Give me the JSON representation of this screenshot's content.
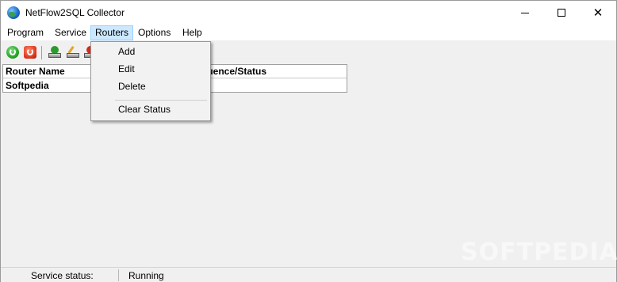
{
  "window": {
    "title": "NetFlow2SQL Collector",
    "close_glyph": "✕"
  },
  "menubar": {
    "items": [
      "Program",
      "Service",
      "Routers",
      "Options",
      "Help"
    ],
    "active": "Routers"
  },
  "toolbar": {
    "buttons": [
      {
        "name": "start-service",
        "icon": "power-on-icon",
        "color": "#1e9a1e"
      },
      {
        "name": "stop-service",
        "icon": "power-off-icon",
        "color": "#d8311a"
      },
      {
        "name": "add-router",
        "icon": "router-add-icon"
      },
      {
        "name": "edit-router",
        "icon": "router-edit-icon"
      },
      {
        "name": "delete-router",
        "icon": "router-delete-icon"
      }
    ]
  },
  "listview": {
    "columns": [
      "Router Name",
      "quence/Status"
    ],
    "rows": [
      {
        "name": "Softpedia",
        "status": ""
      }
    ]
  },
  "dropdown": {
    "items": [
      "Add",
      "Edit",
      "Delete",
      "Clear Status"
    ]
  },
  "statusbar": {
    "label": "Service status:",
    "value": "Running"
  },
  "watermark": "SOFTPEDIA",
  "colors": {
    "menu_active_bg": "#cce8ff",
    "menu_active_border": "#99d1ff",
    "window_bg": "#f0f0f0"
  }
}
